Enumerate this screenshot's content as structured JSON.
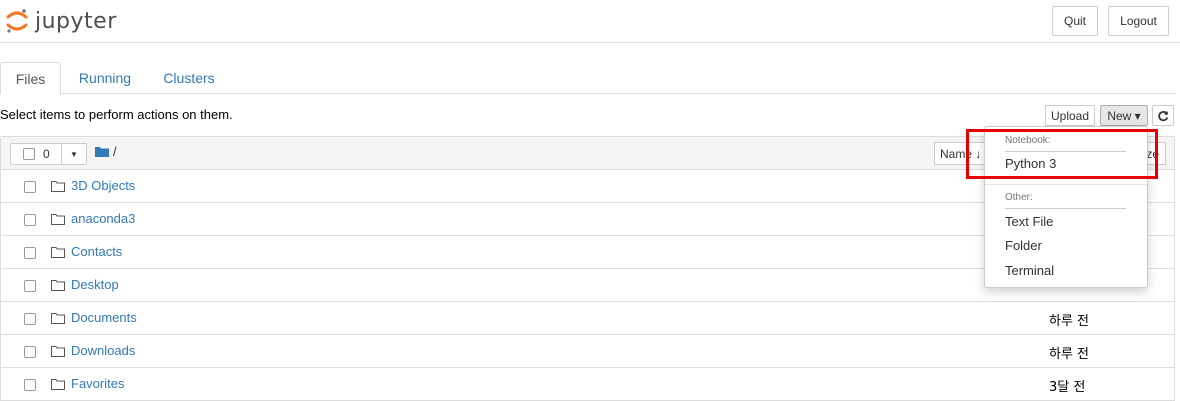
{
  "header": {
    "logo_text": "jupyter",
    "quit_label": "Quit",
    "logout_label": "Logout"
  },
  "tabs": [
    {
      "label": "Files"
    },
    {
      "label": "Running"
    },
    {
      "label": "Clusters"
    }
  ],
  "toolbar": {
    "hint": "Select items to perform actions on them.",
    "upload_label": "Upload",
    "new_label": "New ▾",
    "refresh_icon": "refresh-icon"
  },
  "list_header": {
    "selected_count": "0",
    "path": "/",
    "name_sort_label": "Name ↓",
    "size_sort_label": "ze"
  },
  "files": [
    {
      "name": "3D Objects",
      "modified": ""
    },
    {
      "name": "anaconda3",
      "modified": ""
    },
    {
      "name": "Contacts",
      "modified": ""
    },
    {
      "name": "Desktop",
      "modified": ""
    },
    {
      "name": "Documents",
      "modified": "하루 전"
    },
    {
      "name": "Downloads",
      "modified": "하루 전"
    },
    {
      "name": "Favorites",
      "modified": "3달 전"
    }
  ],
  "new_menu": {
    "notebook_header": "Notebook:",
    "python3": "Python 3",
    "other_header": "Other:",
    "text_file": "Text File",
    "folder": "Folder",
    "terminal": "Terminal"
  },
  "colors": {
    "link": "#337ab7",
    "logo_orange": "#f37726",
    "highlight": "#e60000"
  }
}
